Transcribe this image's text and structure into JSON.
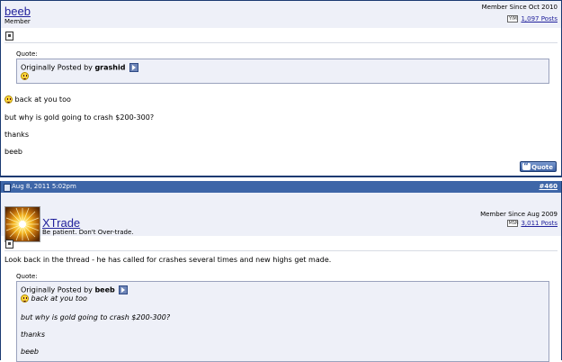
{
  "post1": {
    "username": "beeb",
    "user_title": "Member",
    "member_since": "Member Since Oct 2010",
    "im_icon_label": "YIM",
    "posts_count": "1,097 Posts",
    "quote_label": "Quote:",
    "quote_originally": "Originally Posted by",
    "quote_author": "grashid",
    "body_lines": [
      "back at you too",
      "but why is gold going to crash $200-300?",
      "thanks",
      "beeb"
    ],
    "quote_button": "Quote"
  },
  "post2": {
    "date": "Aug 8, 2011 5:02pm",
    "post_number": "#460",
    "username": "XTrade",
    "user_title": "Be patient. Don't Over-trade.",
    "member_since": "Member Since Aug 2009",
    "im_icon_label": "MSN",
    "posts_count": "3,011 Posts",
    "body_text": "Look back in the thread - he has called for crashes several times and new highs get made.",
    "quote_label": "Quote:",
    "quote_originally": "Originally Posted by",
    "quote_author": "beeb",
    "quote_lines": [
      "back at you too",
      "but why is gold going to crash $200-300?",
      "thanks",
      "beeb"
    ]
  },
  "colors": {
    "header_bar": "#3e66a8",
    "userbar_bg": "#eef0f8",
    "link": "#22229c"
  }
}
